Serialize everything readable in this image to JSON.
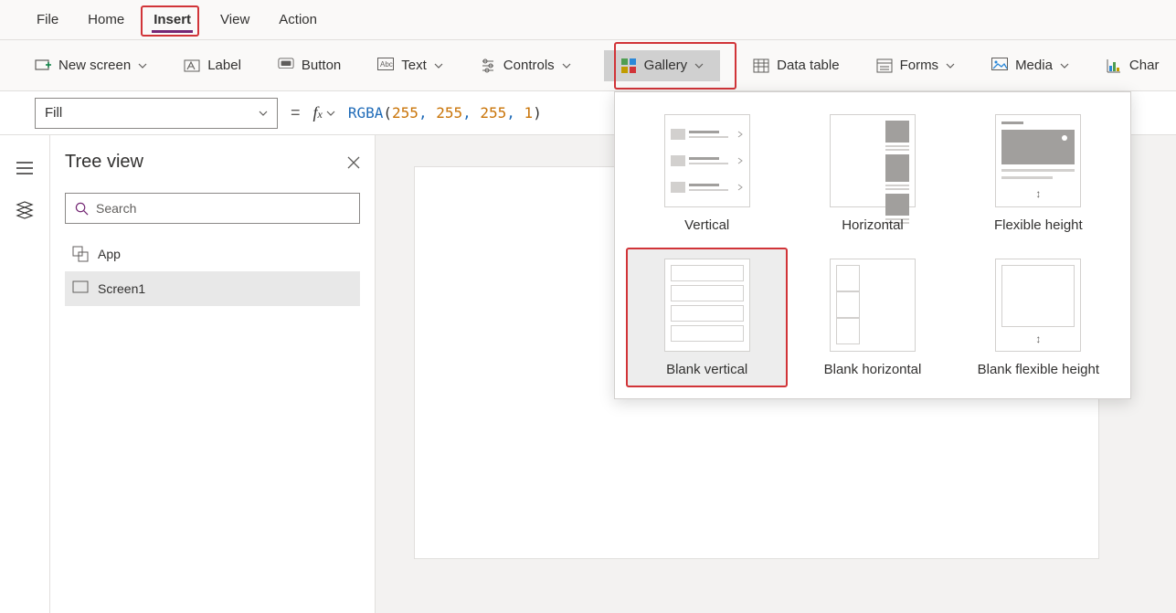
{
  "menu": {
    "items": [
      "File",
      "Home",
      "Insert",
      "View",
      "Action"
    ],
    "active": "Insert"
  },
  "ribbon": {
    "new_screen": "New screen",
    "label": "Label",
    "button": "Button",
    "text": "Text",
    "controls": "Controls",
    "gallery": "Gallery",
    "data_table": "Data table",
    "forms": "Forms",
    "media": "Media",
    "charts": "Char"
  },
  "formula": {
    "property": "Fill",
    "func": "RGBA",
    "args": [
      "255",
      "255",
      "255",
      "1"
    ]
  },
  "tree": {
    "title": "Tree view",
    "search_placeholder": "Search",
    "items": [
      {
        "label": "App",
        "icon": "app"
      },
      {
        "label": "Screen1",
        "icon": "screen",
        "selected": true
      }
    ]
  },
  "gallery_menu": {
    "options": [
      {
        "label": "Vertical",
        "kind": "vertical"
      },
      {
        "label": "Horizontal",
        "kind": "horizontal"
      },
      {
        "label": "Flexible height",
        "kind": "flex"
      },
      {
        "label": "Blank vertical",
        "kind": "blank_v",
        "selected": true
      },
      {
        "label": "Blank horizontal",
        "kind": "blank_h"
      },
      {
        "label": "Blank flexible height",
        "kind": "blank_f"
      }
    ]
  }
}
